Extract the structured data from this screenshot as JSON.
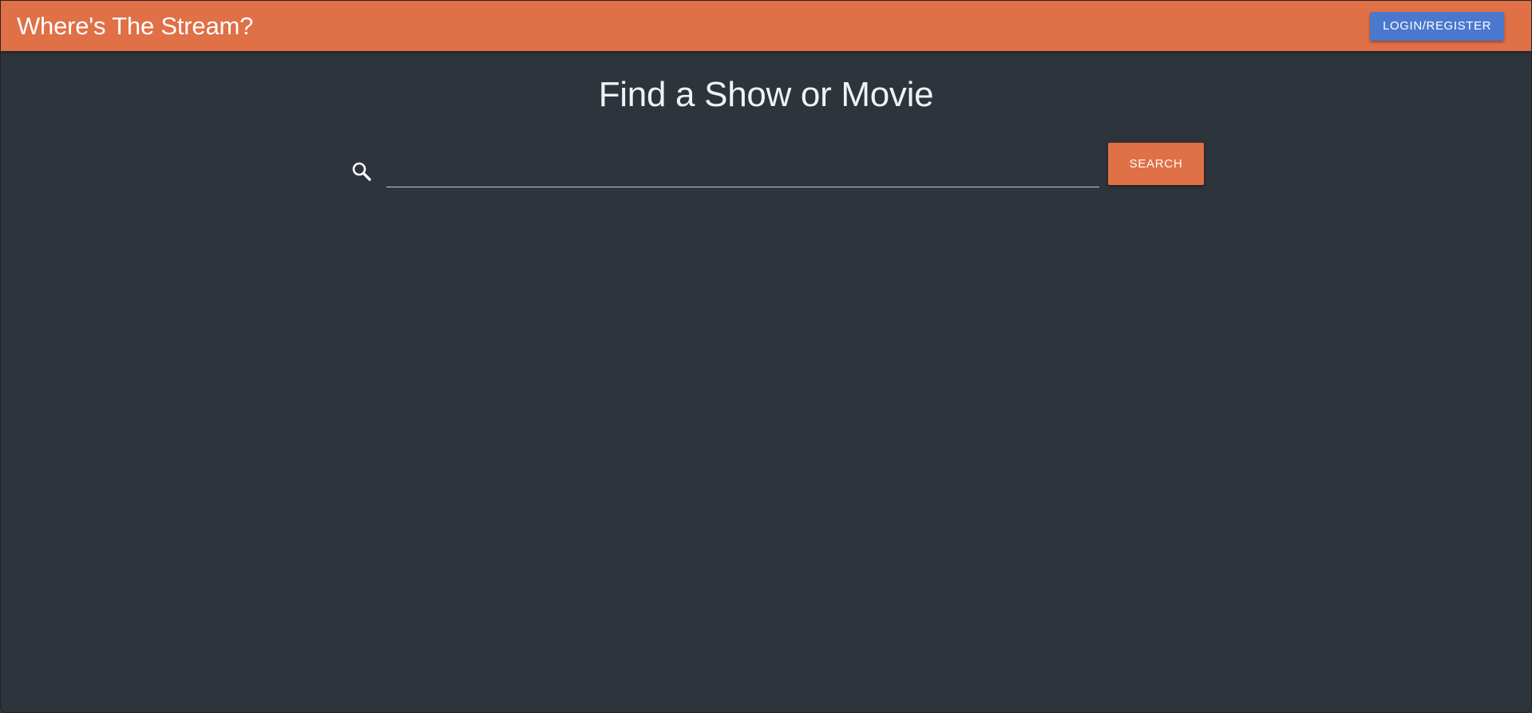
{
  "header": {
    "title": "Where's The Stream?",
    "login_label": "LOGIN/REGISTER"
  },
  "main": {
    "heading": "Find a Show or Movie",
    "search": {
      "value": "",
      "placeholder": "",
      "icon": "search-icon",
      "button_label": "SEARCH"
    }
  },
  "colors": {
    "accent": "#e07046",
    "login_button": "#4a78cf",
    "background": "#2e343b"
  }
}
